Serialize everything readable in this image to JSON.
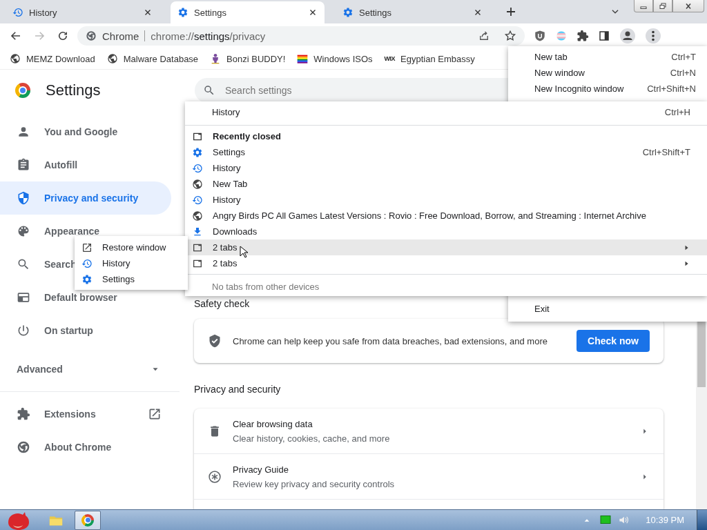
{
  "tabs": [
    {
      "title": "History",
      "kind": "history",
      "selected": false
    },
    {
      "title": "Settings",
      "kind": "gear",
      "selected": true
    },
    {
      "title": "Settings",
      "kind": "gear",
      "selected": false
    }
  ],
  "toolbar": {
    "site_label": "Chrome",
    "url_scheme": "chrome://",
    "url_host": "settings",
    "url_path": "/privacy"
  },
  "bookmarks": [
    {
      "label": "MEMZ Download",
      "kind": "globe"
    },
    {
      "label": "Malware Database",
      "kind": "globe"
    },
    {
      "label": "Bonzi BUDDY!",
      "kind": "figure"
    },
    {
      "label": "Windows ISOs",
      "kind": "flag"
    },
    {
      "label": "Egyptian Embassy",
      "kind": "logo",
      "icon_text": "WIX"
    }
  ],
  "settings": {
    "title": "Settings",
    "search_placeholder": "Search settings",
    "nav": [
      {
        "label": "You and Google",
        "kind": "person",
        "selected": false
      },
      {
        "label": "Autofill",
        "kind": "clipboard",
        "selected": false
      },
      {
        "label": "Privacy and security",
        "kind": "shield",
        "selected": true
      },
      {
        "label": "Appearance",
        "kind": "palette",
        "selected": false
      },
      {
        "label": "Search",
        "kind": "search",
        "selected": false
      },
      {
        "label": "Default browser",
        "kind": "browser",
        "selected": false
      },
      {
        "label": "On startup",
        "kind": "power",
        "selected": false
      }
    ],
    "advanced": {
      "label": "Advanced",
      "expanded": false
    },
    "nav_bottom": [
      {
        "label": "Extensions",
        "kind": "puzzle",
        "external": true
      },
      {
        "label": "About Chrome",
        "kind": "chrome",
        "external": false
      }
    ],
    "safety_check": {
      "heading": "Safety check",
      "text": "Chrome can help keep you safe from data breaches, bad extensions, and more",
      "button": "Check now"
    },
    "section_title": "Privacy and security",
    "rows": [
      {
        "title": "Clear browsing data",
        "subtitle": "Clear history, cookies, cache, and more",
        "kind": "trash"
      },
      {
        "title": "Privacy Guide",
        "subtitle": "Review key privacy and security controls",
        "kind": "guide"
      }
    ]
  },
  "app_menu": {
    "items": [
      {
        "label": "New tab",
        "shortcut": "Ctrl+T"
      },
      {
        "label": "New window",
        "shortcut": "Ctrl+N"
      },
      {
        "label": "New Incognito window",
        "shortcut": "Ctrl+Shift+N"
      }
    ],
    "bottom_items": [
      {
        "label": "Exit"
      }
    ]
  },
  "history_menu": {
    "header": {
      "label": "History",
      "shortcut": "Ctrl+H"
    },
    "recently_closed": "Recently closed",
    "items": [
      {
        "label": "Settings",
        "kind": "gear",
        "shortcut": "Ctrl+Shift+T",
        "submenu": false,
        "selected": false
      },
      {
        "label": "History",
        "kind": "history",
        "submenu": false,
        "selected": false
      },
      {
        "label": "New Tab",
        "kind": "globe",
        "submenu": false,
        "selected": false
      },
      {
        "label": "History",
        "kind": "history",
        "submenu": false,
        "selected": false
      },
      {
        "label": "Angry Birds PC All Games Latest Versions : Rovio : Free Download, Borrow, and Streaming : Internet Archive",
        "kind": "globe",
        "submenu": false,
        "selected": false
      },
      {
        "label": "Downloads",
        "kind": "download",
        "submenu": false,
        "selected": false
      },
      {
        "label": "2 tabs",
        "kind": "window",
        "submenu": true,
        "selected": true
      },
      {
        "label": "2 tabs",
        "kind": "window",
        "submenu": true,
        "selected": false
      }
    ],
    "footer": "No tabs from other devices"
  },
  "window_submenu": {
    "items": [
      {
        "label": "Restore window",
        "kind": "open-in-new"
      },
      {
        "label": "History",
        "kind": "history"
      },
      {
        "label": "Settings",
        "kind": "gear"
      }
    ]
  },
  "taskbar": {
    "time": "10:39 PM"
  }
}
